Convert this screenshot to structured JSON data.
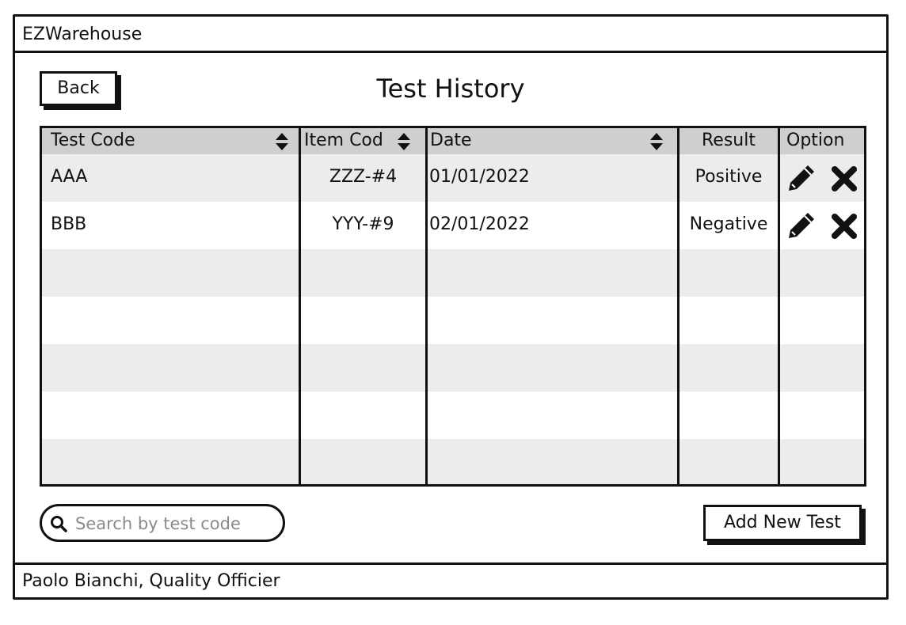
{
  "app": {
    "title": "EZWarehouse"
  },
  "header": {
    "back_label": "Back",
    "page_title": "Test History"
  },
  "table": {
    "columns": [
      "Test Code",
      "Item Cod",
      "Date",
      "Result",
      "Option"
    ],
    "rows": [
      {
        "test_code": "AAA",
        "item_code": "ZZZ-#4",
        "date": "01/01/2022",
        "result": "Positive"
      },
      {
        "test_code": "BBB",
        "item_code": "YYY-#9",
        "date": "02/01/2022",
        "result": "Negative"
      }
    ],
    "sortable_columns": [
      "Test Code",
      "Item Cod",
      "Date"
    ],
    "option_icons": [
      "pencil-icon",
      "close-icon"
    ]
  },
  "search": {
    "placeholder": "Search by test code",
    "value": "",
    "icon": "search-icon"
  },
  "actions": {
    "add_label": "Add New Test"
  },
  "footer": {
    "user": "Paolo Bianchi, Quality Officier"
  },
  "colors": {
    "border": "#111111",
    "header_bg": "#cfcfcf",
    "row_shade": "#ececec",
    "placeholder": "#8a8a8a"
  }
}
